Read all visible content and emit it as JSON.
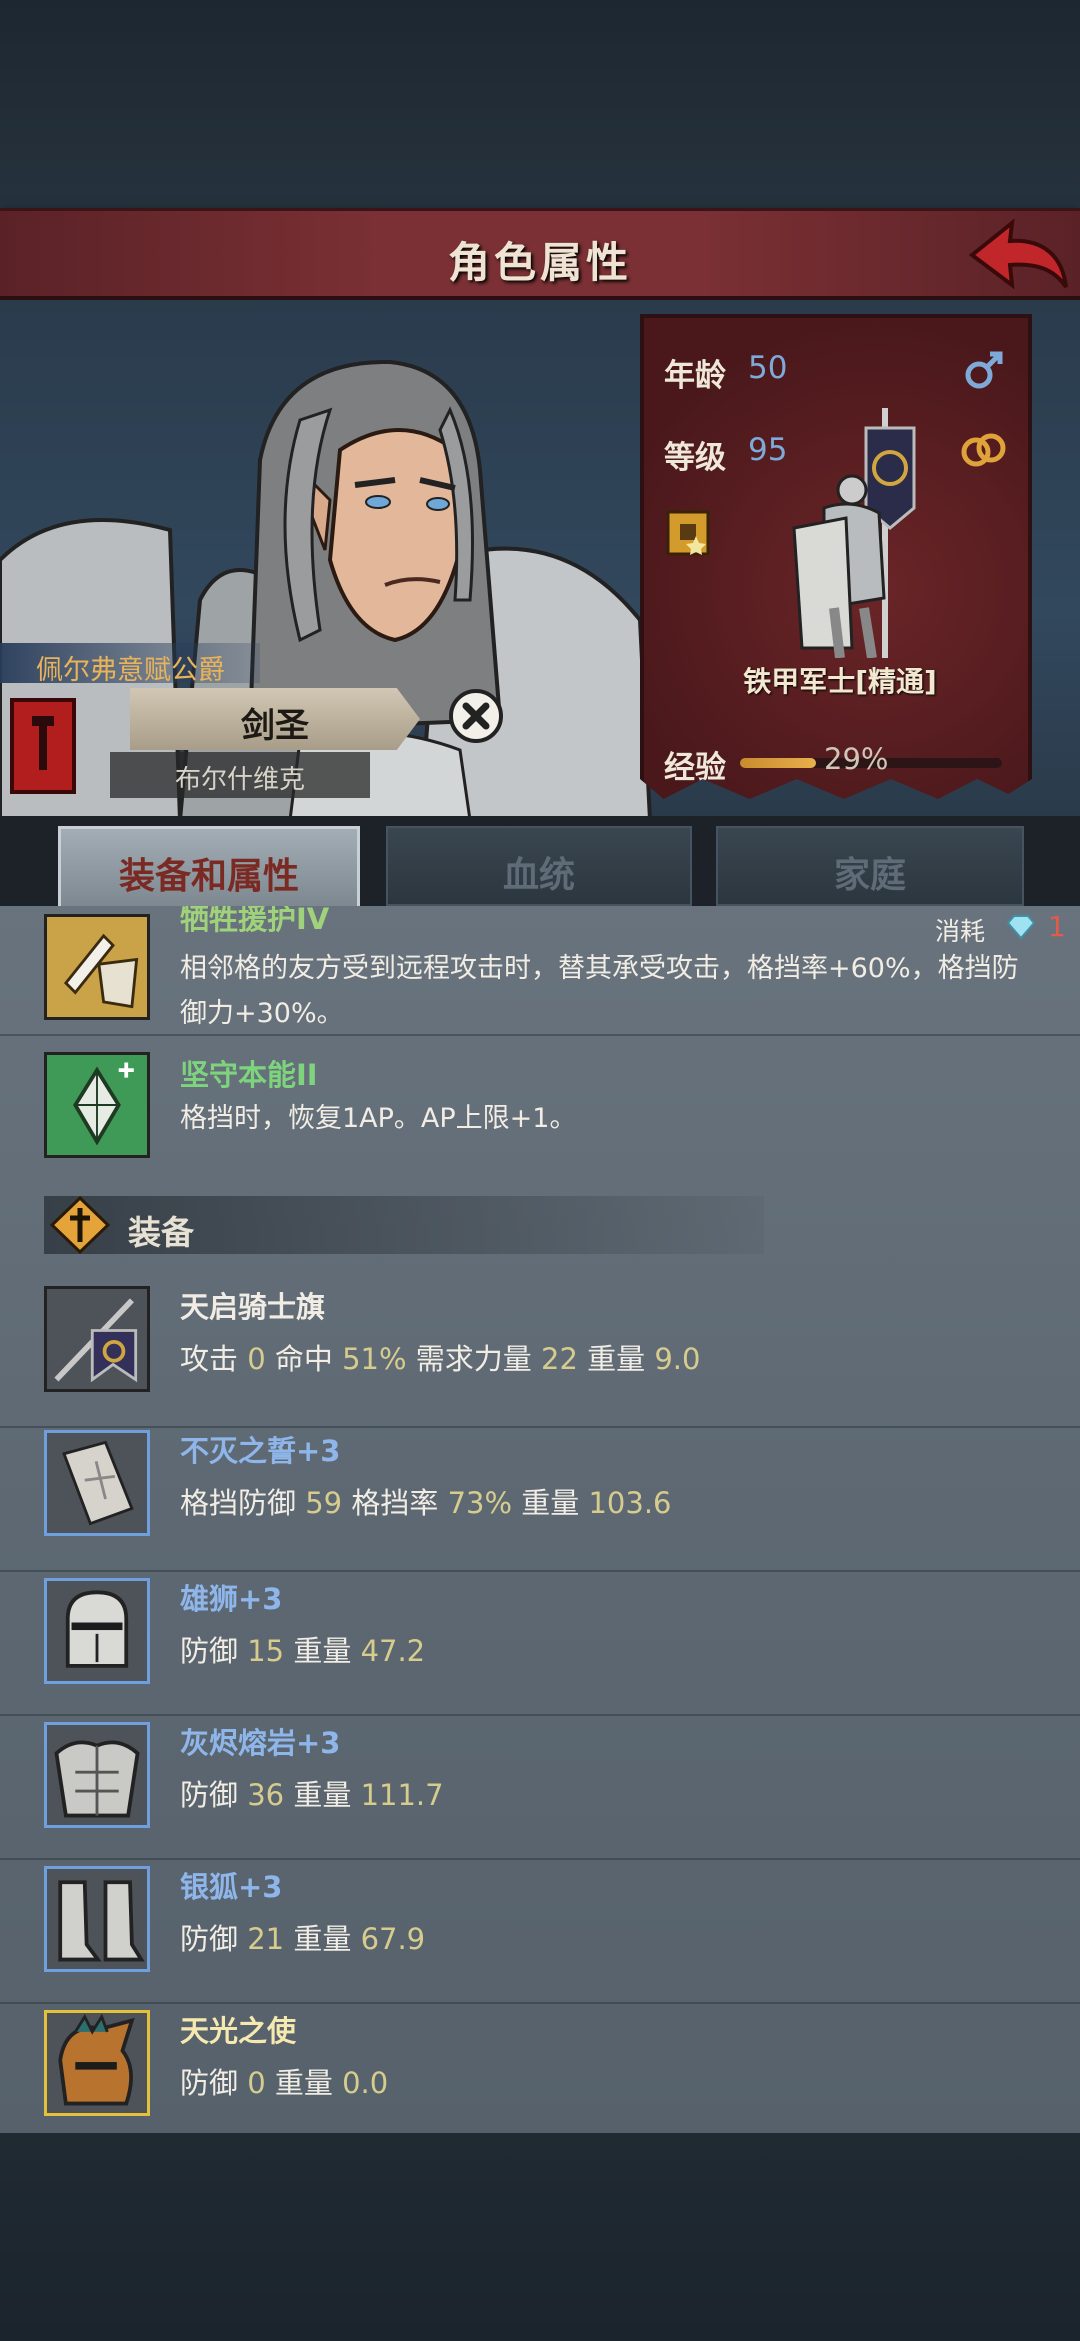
{
  "header": {
    "title": "角色属性"
  },
  "hero": {
    "house": "佩尔弗意赋公爵",
    "title": "剑圣",
    "name": "布尔什维克"
  },
  "stats": {
    "age_label": "年龄",
    "age": "50",
    "level_label": "等级",
    "level": "95",
    "class_name": "铁甲军士[精通]",
    "exp_label": "经验",
    "exp_text": "29%",
    "exp_fraction": 0.29
  },
  "tabs": [
    {
      "label": "装备和属性",
      "active": true
    },
    {
      "label": "血统",
      "active": false
    },
    {
      "label": "家庭",
      "active": false
    }
  ],
  "skills": [
    {
      "name": "牺牲援护IV",
      "desc": "相邻格的友方受到远程攻击时，替其承受攻击，格挡率+60%，格挡防御力+30%。",
      "consume_label": "消耗",
      "consume_value": "1",
      "color": "#9fd27a"
    },
    {
      "name": "坚守本能II",
      "desc": "格挡时，恢复1AP。AP上限+1。",
      "color": "#7ed37d"
    }
  ],
  "section": {
    "title": "装备"
  },
  "equipment": [
    {
      "name": "天启骑士旗",
      "name_color": "#f1ede4",
      "stats": [
        [
          "攻击",
          "0"
        ],
        [
          "命中",
          "51%"
        ],
        [
          "需求力量",
          "22"
        ],
        [
          "重量",
          "9.0"
        ]
      ]
    },
    {
      "name": "不灭之誓+3",
      "name_color": "#8fb6ea",
      "stats": [
        [
          "格挡防御",
          "59"
        ],
        [
          "格挡率",
          "73%"
        ],
        [
          "重量",
          "103.6"
        ]
      ]
    },
    {
      "name": "雄狮+3",
      "name_color": "#8fb6ea",
      "stats": [
        [
          "防御",
          "15"
        ],
        [
          "重量",
          "47.2"
        ]
      ]
    },
    {
      "name": "灰烬熔岩+3",
      "name_color": "#8fb6ea",
      "stats": [
        [
          "防御",
          "36"
        ],
        [
          "重量",
          "111.7"
        ]
      ]
    },
    {
      "name": "银狐+3",
      "name_color": "#8fb6ea",
      "stats": [
        [
          "防御",
          "21"
        ],
        [
          "重量",
          "67.9"
        ]
      ]
    },
    {
      "name": "天光之使",
      "name_color": "#f6e9b0",
      "stats": [
        [
          "防御",
          "0"
        ],
        [
          "重量",
          "0.0"
        ]
      ]
    }
  ],
  "colors": {
    "title_bar": "#7a3034",
    "stat_value": "#7ea9d9",
    "number": "#d6cc8e",
    "tab_active_text": "#7a2a22"
  },
  "icons": [
    "back-arrow-icon",
    "close-circle-icon",
    "male-icon",
    "rings-icon",
    "perk-badge-icon",
    "crest-banner-icon",
    "diamond-icon",
    "cross-emblem-icon"
  ]
}
